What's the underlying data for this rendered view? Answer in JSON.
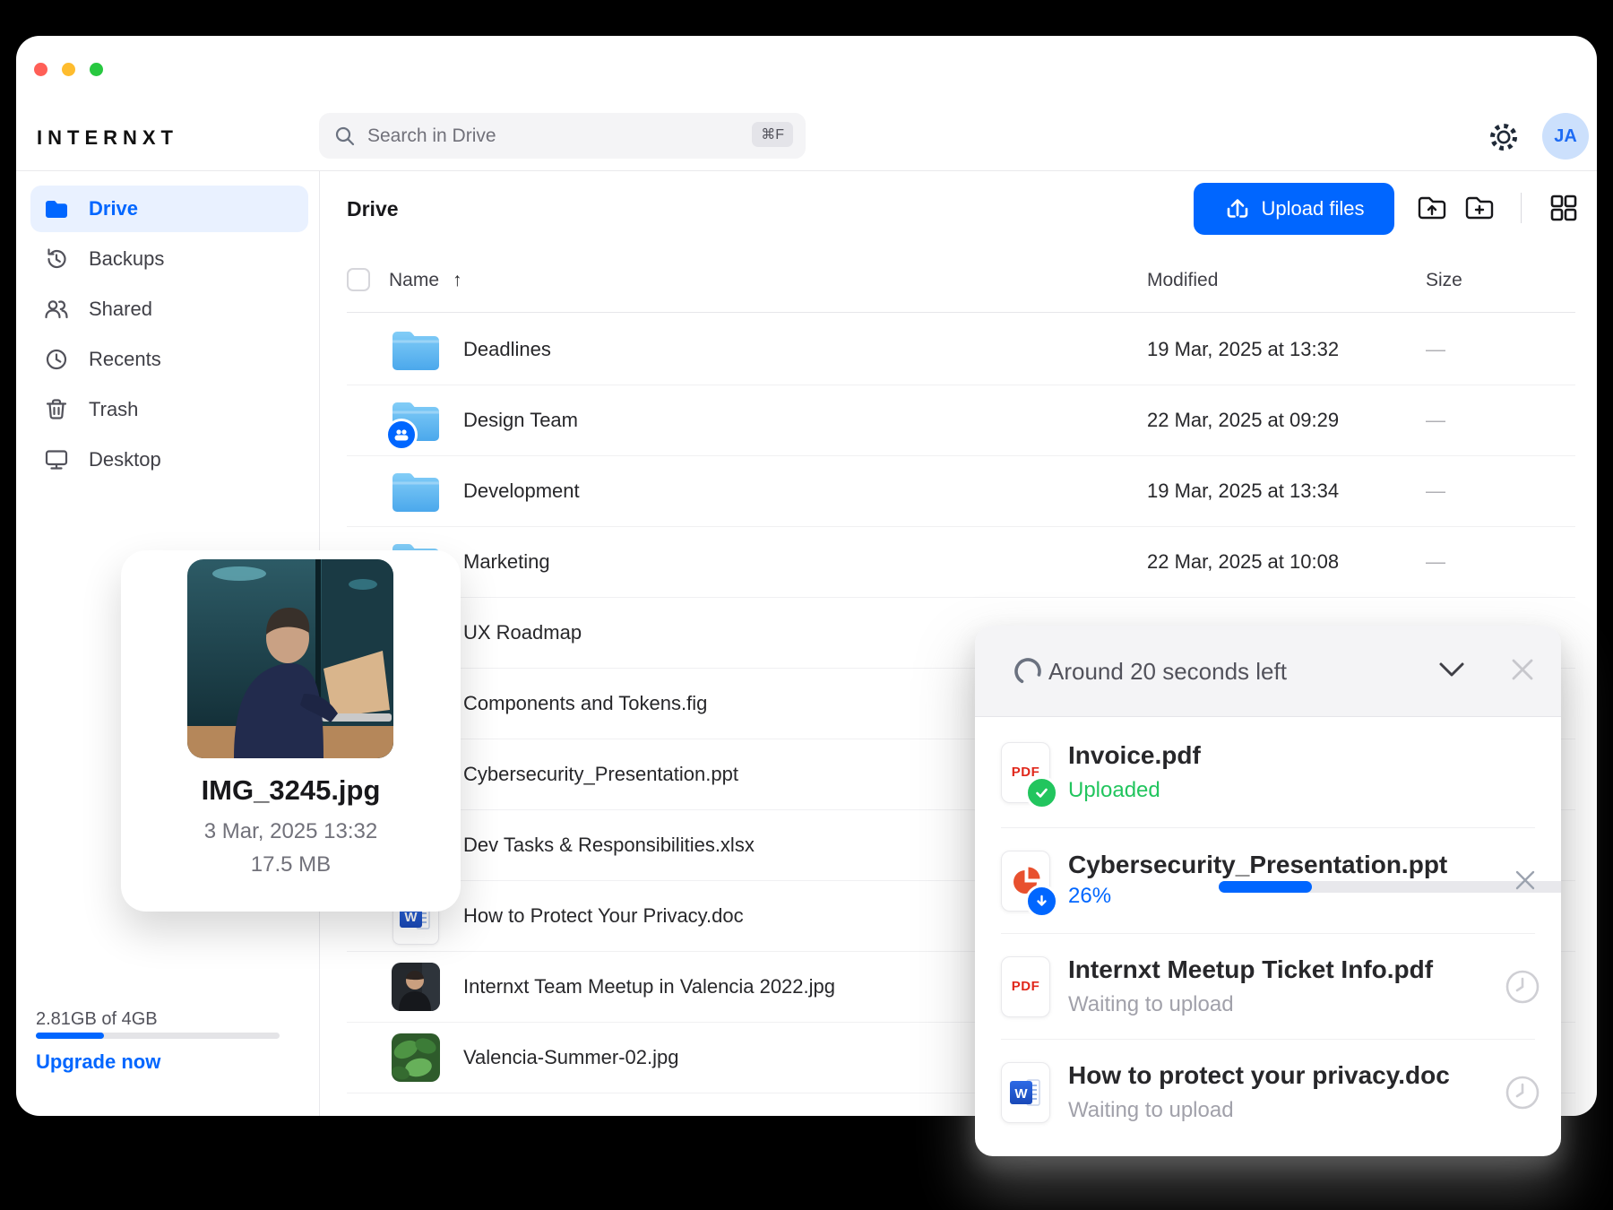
{
  "window": {
    "logo": "INTERNXT",
    "avatar_initials": "JA"
  },
  "search": {
    "placeholder": "Search in Drive",
    "shortcut": "⌘F"
  },
  "sidebar": {
    "items": [
      {
        "label": "Drive"
      },
      {
        "label": "Backups"
      },
      {
        "label": "Shared"
      },
      {
        "label": "Recents"
      },
      {
        "label": "Trash"
      },
      {
        "label": "Desktop"
      }
    ],
    "storage": {
      "usage": "2.81GB of 4GB",
      "percent_used": 28,
      "upgrade_label": "Upgrade now"
    }
  },
  "toolbar": {
    "section_title": "Drive",
    "upload_button_label": "Upload files"
  },
  "table": {
    "columns": {
      "name": "Name",
      "modified": "Modified",
      "size": "Size"
    },
    "sort_indicator": "↑",
    "rows": [
      {
        "name": "Deadlines",
        "type": "folder",
        "modified": "19 Mar, 2025 at 13:32",
        "size": "—"
      },
      {
        "name": "Design Team",
        "type": "shared-folder",
        "modified": "22 Mar, 2025 at 09:29",
        "size": "—"
      },
      {
        "name": "Development",
        "type": "folder",
        "modified": "19 Mar, 2025 at 13:34",
        "size": "—"
      },
      {
        "name": "Marketing",
        "type": "folder",
        "modified": "22 Mar, 2025 at 10:08",
        "size": "—"
      },
      {
        "name": "UX Roadmap",
        "type": "folder",
        "modified": "",
        "size": ""
      },
      {
        "name": "Components and Tokens.fig",
        "type": "file",
        "modified": "",
        "size": ""
      },
      {
        "name": "Cybersecurity_Presentation.ppt",
        "type": "file",
        "modified": "",
        "size": ""
      },
      {
        "name": "Dev Tasks & Responsibilities.xlsx",
        "type": "file",
        "modified": "",
        "size": ""
      },
      {
        "name": "How to Protect Your Privacy.doc",
        "type": "word-doc",
        "modified": "",
        "size": ""
      },
      {
        "name": "Internxt Team Meetup in Valencia 2022.jpg",
        "type": "image",
        "modified": "",
        "size": ""
      },
      {
        "name": "Valencia-Summer-02.jpg",
        "type": "image",
        "modified": "",
        "size": ""
      }
    ]
  },
  "preview_card": {
    "filename": "IMG_3245.jpg",
    "date": "3 Mar, 2025 13:32",
    "size": "17.5 MB"
  },
  "upload_panel": {
    "header_text": "Around 20 seconds left",
    "items": [
      {
        "name": "Invoice.pdf",
        "status": "Uploaded",
        "file_type": "pdf"
      },
      {
        "name": "Cybersecurity_Presentation.ppt",
        "status": "26%",
        "file_type": "ppt",
        "progress_percent": 26
      },
      {
        "name": "Internxt Meetup Ticket Info.pdf",
        "status": "Waiting to upload",
        "file_type": "pdf"
      },
      {
        "name": "How to protect your privacy.doc",
        "status": "Waiting to upload",
        "file_type": "doc"
      }
    ]
  },
  "icons": {
    "pdf_label": "PDF",
    "word_label": "W"
  },
  "colors": {
    "accent": "#0066FF",
    "success": "#22C55E"
  }
}
